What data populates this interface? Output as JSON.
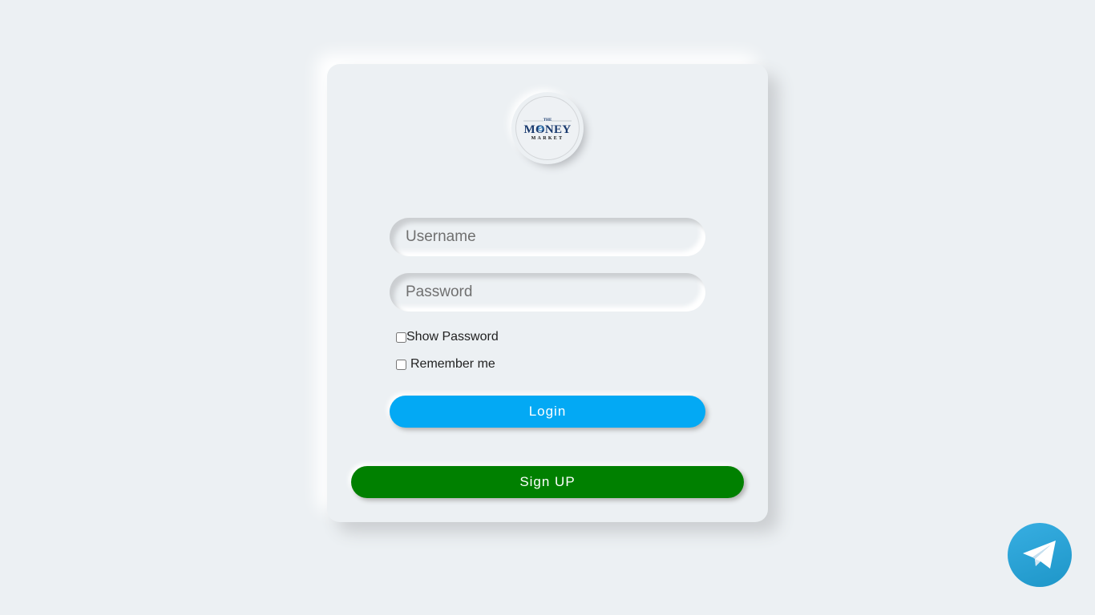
{
  "login_form": {
    "logo": {
      "top_text": "THE",
      "main_text": "MONEY",
      "sub_text": "MARKET",
      "brand_color": "#1a3a6e"
    },
    "username": {
      "placeholder": "Username",
      "value": ""
    },
    "password": {
      "placeholder": "Password",
      "value": ""
    },
    "show_password_label": "Show Password",
    "remember_me_label": "Remember me",
    "login_button_label": "Login",
    "signup_button_label": "Sign UP",
    "colors": {
      "background": "#ecf0f3",
      "login_button": "#03a9f4",
      "signup_button": "#008000"
    }
  },
  "floating": {
    "telegram_icon": "telegram-icon",
    "telegram_color": "#2aa3dd"
  }
}
